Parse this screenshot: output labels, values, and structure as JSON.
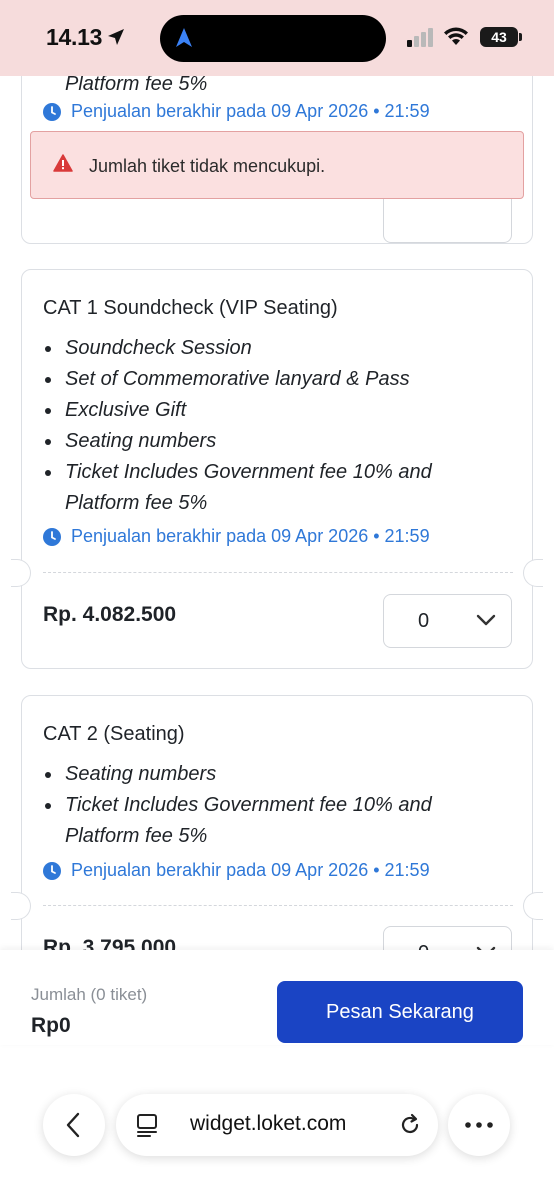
{
  "status_bar": {
    "time": "14.13",
    "battery": "43"
  },
  "cards": [
    {
      "benefits_tail": "Platform fee 5%",
      "sale_end": "Penjualan berakhir pada 09 Apr 2026 • 21:59"
    },
    {
      "title": "CAT 1 Soundcheck (VIP Seating)",
      "benefits": [
        "Soundcheck Session",
        "Set of Commemorative lanyard & Pass",
        "Exclusive Gift",
        "Seating numbers",
        "Ticket Includes Government fee 10% and Platform fee 5%"
      ],
      "sale_end": "Penjualan berakhir pada 09 Apr 2026 • 21:59",
      "price": "Rp. 4.082.500",
      "quantity": "0"
    },
    {
      "title": "CAT 2 (Seating)",
      "benefits": [
        "Seating numbers",
        "Ticket Includes Government fee 10% and Platform fee 5%"
      ],
      "sale_end": "Penjualan berakhir pada 09 Apr 2026 • 21:59",
      "price": "Rp. 3.795.000",
      "quantity": "0"
    }
  ],
  "error_toast": {
    "message": "Jumlah tiket tidak mencukupi."
  },
  "order_bar": {
    "quantity_label": "Jumlah (0 tiket)",
    "total": "Rp0",
    "order_button": "Pesan Sekarang"
  },
  "browser": {
    "url": "widget.loket.com"
  },
  "colors": {
    "accent": "#1a44c4",
    "link": "#2f78d8",
    "error_bg": "#fbe0e0",
    "error_icon": "#d93a3a",
    "status_bar_bg": "#f6dcdc"
  },
  "icons": [
    "navigation-arrow-icon",
    "signal-icon",
    "wifi-icon",
    "battery-icon",
    "clock-icon",
    "chevron-down-icon",
    "error-icon",
    "back-icon",
    "page-icon",
    "reload-icon",
    "more-icon"
  ]
}
